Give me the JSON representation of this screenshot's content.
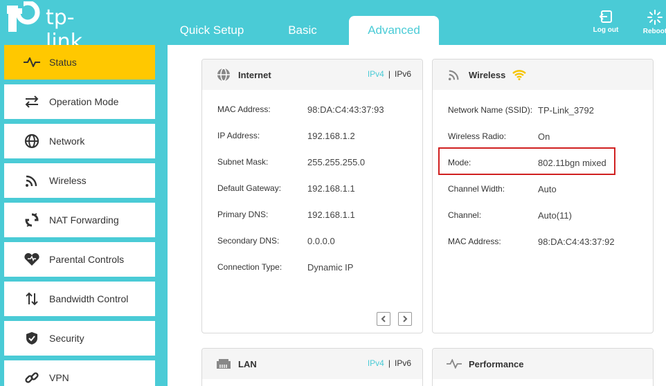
{
  "brand": {
    "name": "tp-link"
  },
  "nav": {
    "tabs": [
      {
        "label": "Quick Setup"
      },
      {
        "label": "Basic"
      },
      {
        "label": "Advanced"
      }
    ],
    "logout_label": "Log out",
    "reboot_label": "Reboot"
  },
  "sidebar": {
    "items": [
      {
        "label": "Status",
        "icon": "pulse-icon",
        "active": true
      },
      {
        "label": "Operation Mode",
        "icon": "swap-icon"
      },
      {
        "label": "Network",
        "icon": "globe-icon"
      },
      {
        "label": "Wireless",
        "icon": "wifi-signal-icon"
      },
      {
        "label": "NAT Forwarding",
        "icon": "nat-icon"
      },
      {
        "label": "Parental Controls",
        "icon": "heart-icon"
      },
      {
        "label": "Bandwidth Control",
        "icon": "arrows-updown-icon"
      },
      {
        "label": "Security",
        "icon": "shield-icon"
      },
      {
        "label": "VPN",
        "icon": "link-icon"
      }
    ]
  },
  "internet": {
    "title": "Internet",
    "ipv4": "IPv4",
    "sep": "|",
    "ipv6": "IPv6",
    "rows": [
      {
        "k": "MAC Address:",
        "v": "98:DA:C4:43:37:93"
      },
      {
        "k": "IP Address:",
        "v": "192.168.1.2"
      },
      {
        "k": "Subnet Mask:",
        "v": "255.255.255.0"
      },
      {
        "k": "Default Gateway:",
        "v": "192.168.1.1"
      },
      {
        "k": "Primary DNS:",
        "v": "192.168.1.1"
      },
      {
        "k": "Secondary DNS:",
        "v": "0.0.0.0"
      },
      {
        "k": "Connection Type:",
        "v": "Dynamic IP"
      }
    ]
  },
  "wireless": {
    "title": "Wireless",
    "rows": [
      {
        "k": "Network Name (SSID):",
        "v": "TP-Link_3792"
      },
      {
        "k": "Wireless Radio:",
        "v": "On"
      },
      {
        "k": "Mode:",
        "v": "802.11bgn mixed"
      },
      {
        "k": "Channel Width:",
        "v": "Auto"
      },
      {
        "k": "Channel:",
        "v": "Auto(11)"
      },
      {
        "k": "MAC Address:",
        "v": "98:DA:C4:43:37:92"
      }
    ]
  },
  "lan": {
    "title": "LAN",
    "ipv4": "IPv4",
    "sep": "|",
    "ipv6": "IPv6"
  },
  "performance": {
    "title": "Performance"
  },
  "colors": {
    "accent": "#4acbd6",
    "active": "#ffc800",
    "highlight": "#d02020",
    "wifi_status": "#f5c400"
  }
}
